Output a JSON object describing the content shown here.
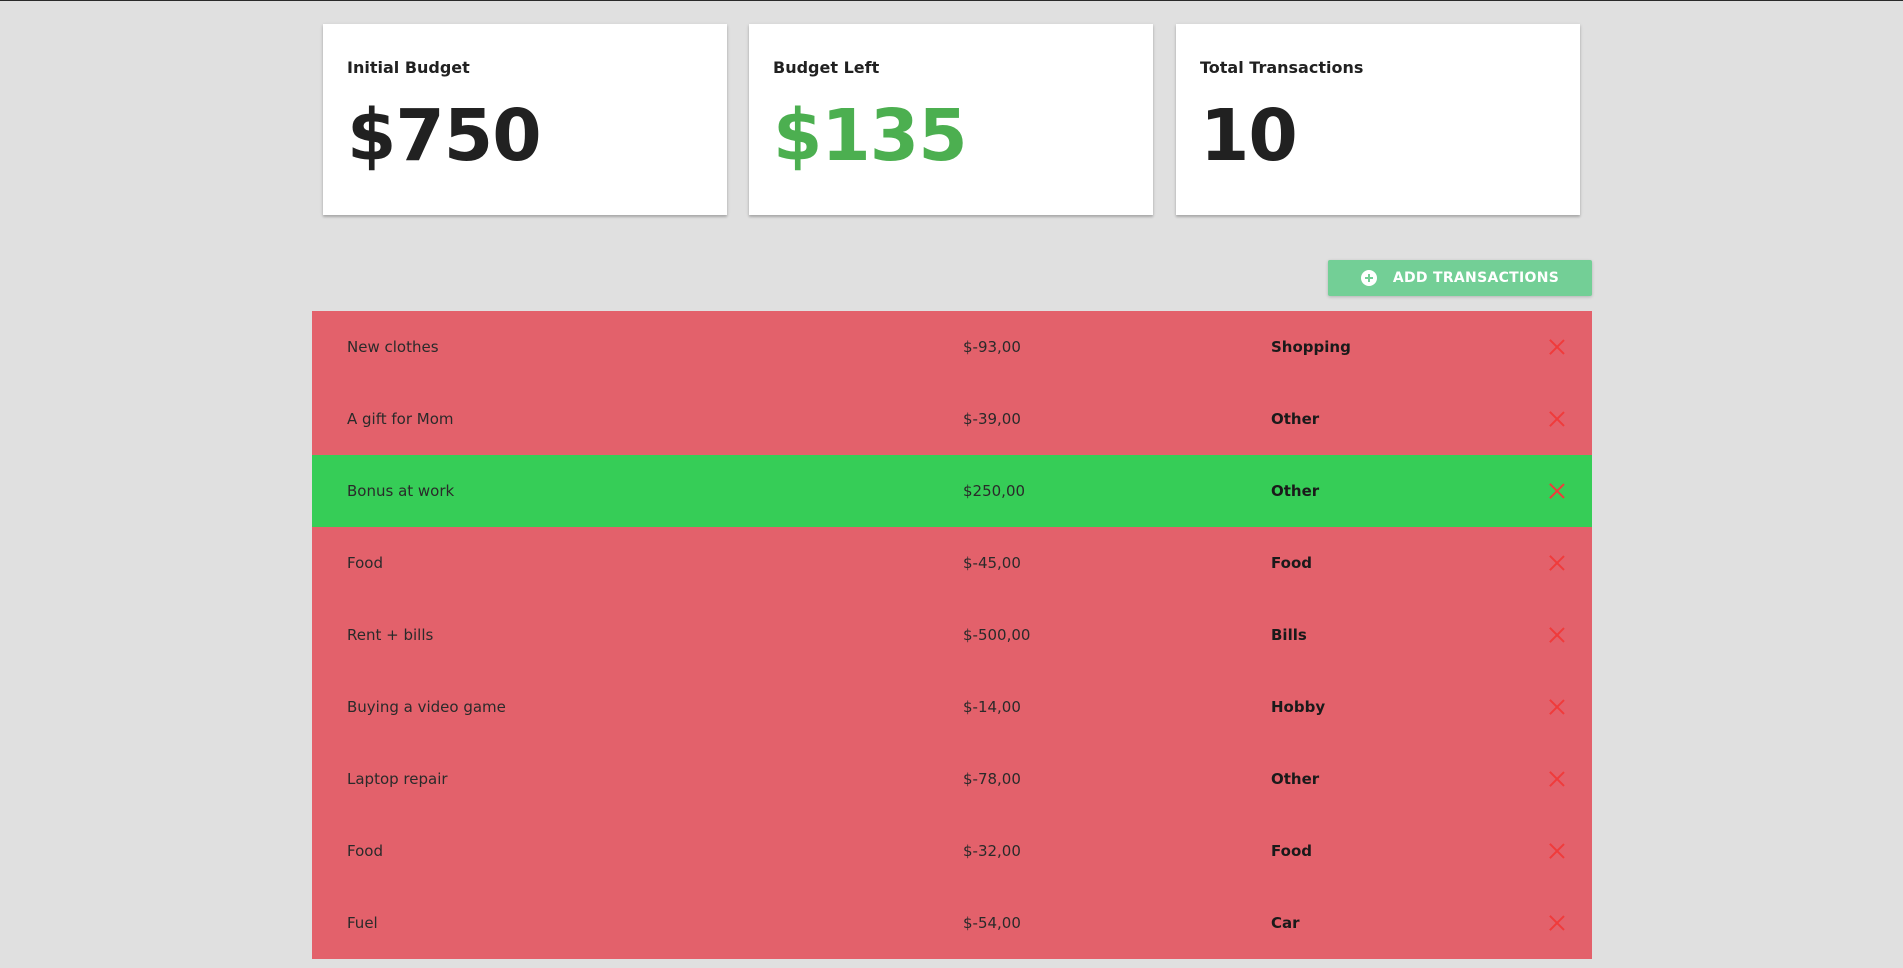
{
  "summary": {
    "initial_budget": {
      "label": "Initial Budget",
      "value": "$750"
    },
    "budget_left": {
      "label": "Budget Left",
      "value": "$135",
      "color": "#4caf50"
    },
    "total_transactions": {
      "label": "Total Transactions",
      "value": "10"
    }
  },
  "actions": {
    "add_label": "ADD TRANSACTIONS",
    "add_icon": "add-circle-icon"
  },
  "colors": {
    "expense_row": "#e3616b",
    "income_row": "#36cd57",
    "add_button": "#73cf96",
    "delete_icon": "#f03b3b"
  },
  "transactions": [
    {
      "description": "New clothes",
      "amount": "$-93,00",
      "category": "Shopping",
      "type": "expense"
    },
    {
      "description": "A gift for Mom",
      "amount": "$-39,00",
      "category": "Other",
      "type": "expense"
    },
    {
      "description": "Bonus at work",
      "amount": "$250,00",
      "category": "Other",
      "type": "income"
    },
    {
      "description": "Food",
      "amount": "$-45,00",
      "category": "Food",
      "type": "expense"
    },
    {
      "description": "Rent + bills",
      "amount": "$-500,00",
      "category": "Bills",
      "type": "expense"
    },
    {
      "description": "Buying a video game",
      "amount": "$-14,00",
      "category": "Hobby",
      "type": "expense"
    },
    {
      "description": "Laptop repair",
      "amount": "$-78,00",
      "category": "Other",
      "type": "expense"
    },
    {
      "description": "Food",
      "amount": "$-32,00",
      "category": "Food",
      "type": "expense"
    },
    {
      "description": "Fuel",
      "amount": "$-54,00",
      "category": "Car",
      "type": "expense"
    }
  ]
}
